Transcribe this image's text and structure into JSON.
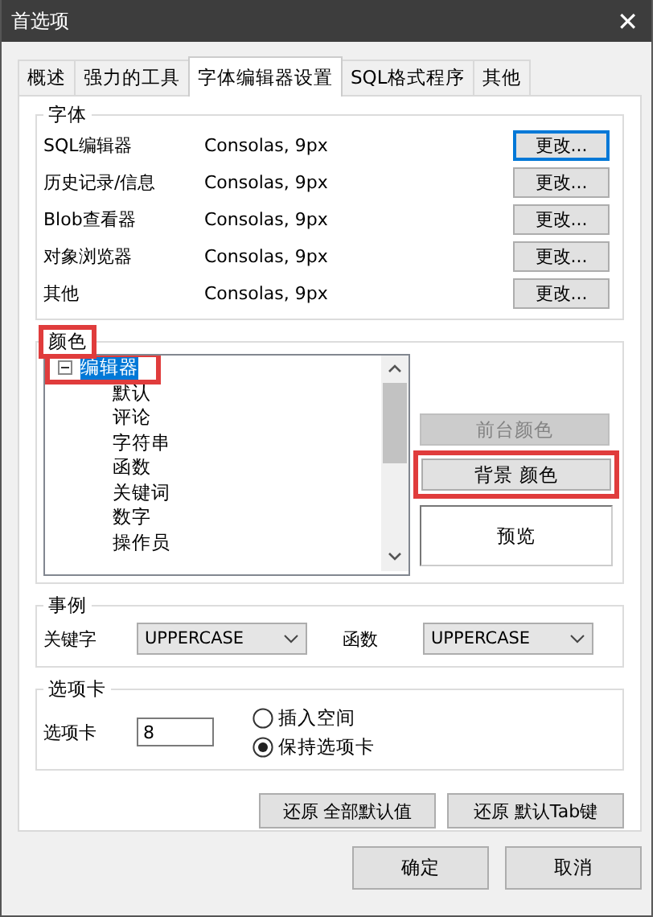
{
  "window": {
    "title": "首选项",
    "close": "✕"
  },
  "tabs": [
    {
      "label": "概述",
      "selected": false
    },
    {
      "label": "强力的工具",
      "selected": false
    },
    {
      "label": "字体编辑器设置",
      "selected": true
    },
    {
      "label": "SQL格式程序",
      "selected": false
    },
    {
      "label": "其他",
      "selected": false
    }
  ],
  "fonts": {
    "title": "字体",
    "rows": [
      {
        "name": "SQL编辑器",
        "value": "Consolas, 9px",
        "button": "更改...",
        "focused": true
      },
      {
        "name": "历史记录/信息",
        "value": "Consolas, 9px",
        "button": "更改...",
        "focused": false
      },
      {
        "name": "Blob查看器",
        "value": "Consolas, 9px",
        "button": "更改...",
        "focused": false
      },
      {
        "name": "对象浏览器",
        "value": "Consolas, 9px",
        "button": "更改...",
        "focused": false
      },
      {
        "name": "其他",
        "value": "Consolas, 9px",
        "button": "更改...",
        "focused": false
      }
    ]
  },
  "colors": {
    "title": "颜色",
    "highlighted": true,
    "tree": [
      {
        "label": "编辑器",
        "expanded": true,
        "selected": true,
        "children": [
          {
            "label": "默认",
            "selected": false
          },
          {
            "label": "评论",
            "selected": false
          },
          {
            "label": "字符串",
            "selected": false
          },
          {
            "label": "函数",
            "selected": false
          },
          {
            "label": "关键词",
            "selected": false
          },
          {
            "label": "数字",
            "selected": false
          },
          {
            "label": "操作员",
            "selected": false
          }
        ]
      }
    ],
    "foreground_button": {
      "label": "前台颜色",
      "disabled": true
    },
    "background_button": {
      "label": "背景 颜色",
      "disabled": false,
      "highlighted": true
    },
    "preview": "预览"
  },
  "case": {
    "title": "事例",
    "fields": [
      {
        "label": "关键字",
        "value": "UPPERCASE"
      },
      {
        "label": "函数",
        "value": "UPPERCASE"
      }
    ]
  },
  "tab_group": {
    "title": "选项卡",
    "label": "选项卡",
    "value": "8",
    "options": [
      {
        "label": "插入空间",
        "selected": false
      },
      {
        "label": "保持选项卡",
        "selected": true
      }
    ]
  },
  "restore_buttons": [
    "还原 全部默认值",
    "还原 默认Tab键"
  ],
  "buttons": [
    "确定",
    "取消"
  ]
}
